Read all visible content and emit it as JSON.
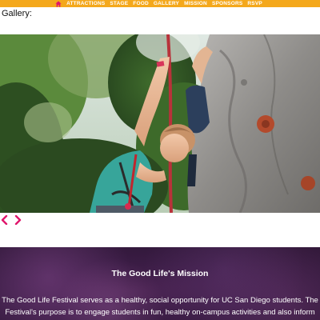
{
  "nav": {
    "home_icon": "home-icon",
    "items": [
      "ATTRACTIONS",
      "STAGE",
      "FOOD",
      "GALLERY",
      "MISSION",
      "SPONSORS",
      "RSVP"
    ]
  },
  "gallery": {
    "heading": "Gallery:",
    "prev_icon": "chevron-left-icon",
    "next_icon": "chevron-right-icon",
    "photo_alt": "Woman climbing a rock wall"
  },
  "mission": {
    "title": "The Good Life's Mission",
    "text_line1": "The Good Life Festival serves as a healthy, social opportunity for UC San Diego students. The",
    "text_line2": "Festival's purpose is to engage students in fun, healthy on-campus activities and also inform students"
  },
  "colors": {
    "nav_bg": "#f4a81c",
    "accent": "#e0166b",
    "mission_bg": "#3a1c44"
  }
}
